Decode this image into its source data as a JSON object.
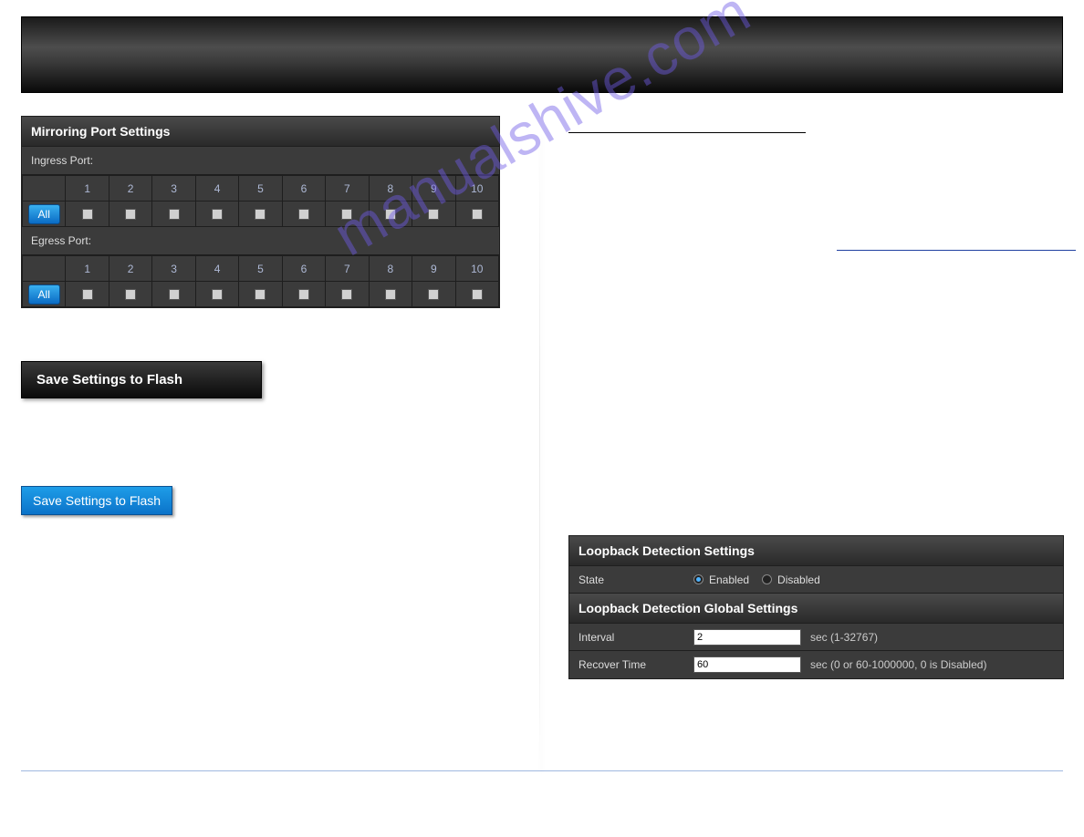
{
  "watermark": "manualshive.com",
  "mirroring": {
    "title": "Mirroring Port Settings",
    "ingress_label": "Ingress Port:",
    "egress_label": "Egress Port:",
    "all_label": "All",
    "ports": [
      "1",
      "2",
      "3",
      "4",
      "5",
      "6",
      "7",
      "8",
      "9",
      "10"
    ]
  },
  "buttons": {
    "save_flash_dark": "Save Settings to Flash",
    "save_flash_blue": "Save Settings to Flash"
  },
  "loopback": {
    "title1": "Loopback Detection Settings",
    "state_label": "State",
    "enabled_label": "Enabled",
    "disabled_label": "Disabled",
    "title2": "Loopback Detection Global Settings",
    "interval_label": "Interval",
    "interval_value": "2",
    "interval_hint": "sec (1-32767)",
    "recover_label": "Recover Time",
    "recover_value": "60",
    "recover_hint": "sec (0 or 60-1000000, 0 is Disabled)"
  }
}
